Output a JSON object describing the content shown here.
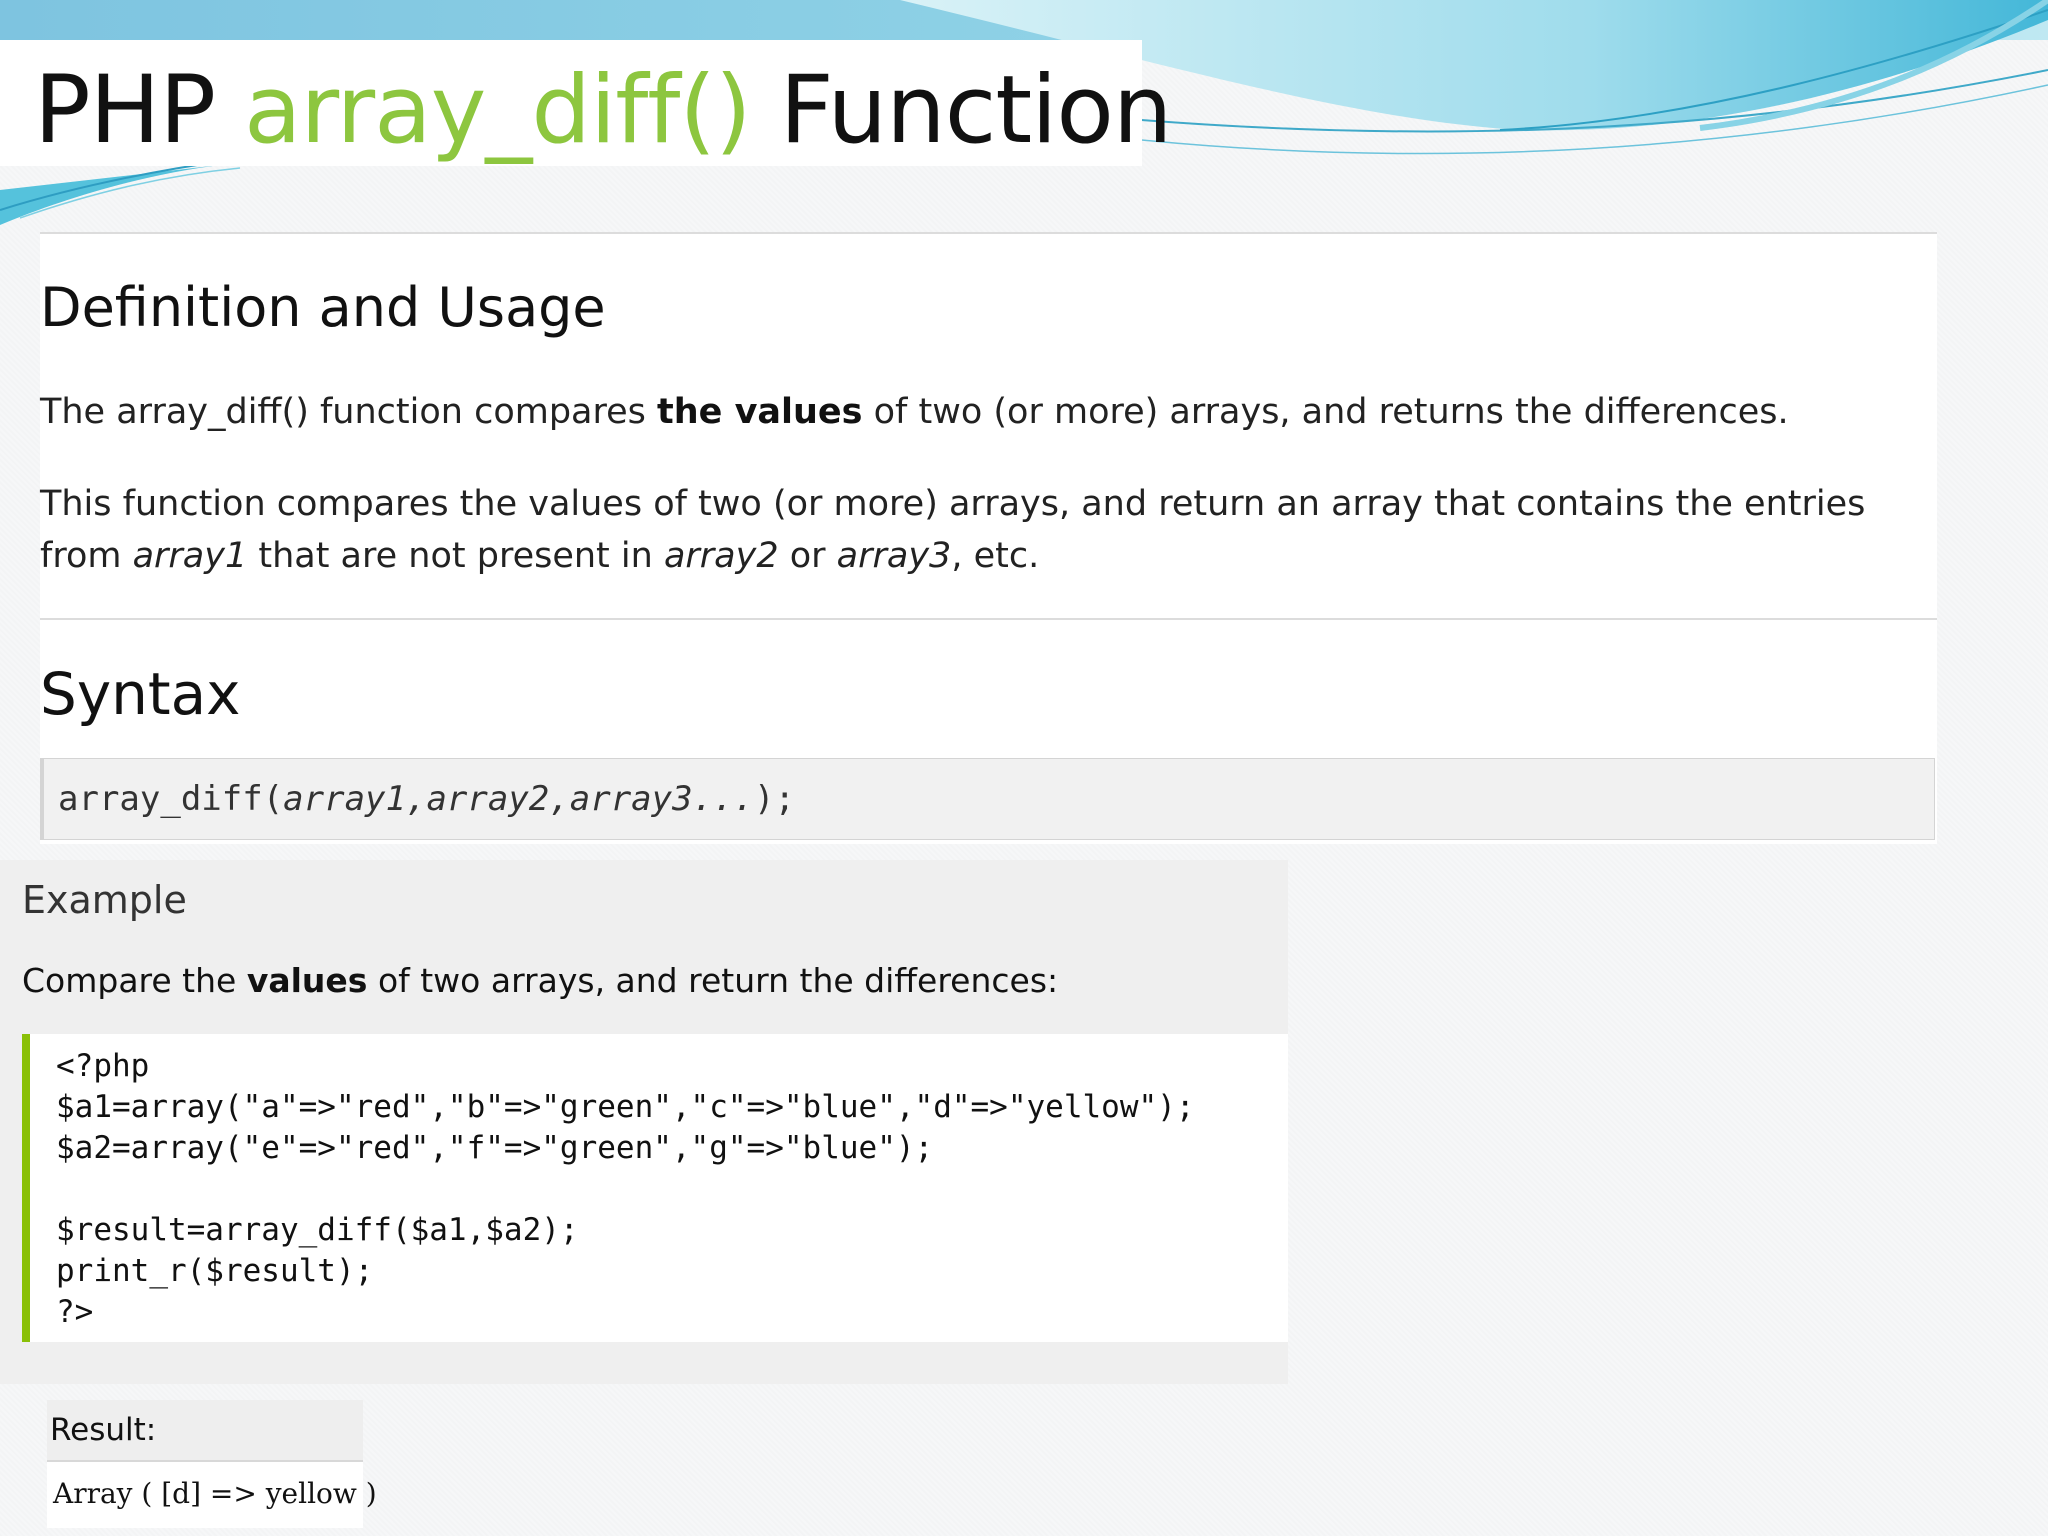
{
  "slide": {
    "title_prefix": "PHP ",
    "title_function": "array_diff()",
    "title_suffix": " Function"
  },
  "definition": {
    "heading": "Definition and Usage",
    "p1_before": "The array_diff() function compares ",
    "p1_bold": "the values",
    "p1_after": " of two (or more) arrays, and returns the differences.",
    "p2_start": "This function compares the values of two (or more) arrays, and return an array that contains the entries from ",
    "p2_em1": "array1",
    "p2_mid1": " that are not present in ",
    "p2_em2": "array2",
    "p2_mid2": " or ",
    "p2_em3": "array3",
    "p2_end": ", etc."
  },
  "syntax": {
    "heading": "Syntax",
    "code_fn": "array_diff(",
    "code_args": "array1,array2,array3...",
    "code_end": ");"
  },
  "example": {
    "heading": "Example",
    "desc_before": "Compare the ",
    "desc_bold": "values",
    "desc_after": " of two arrays, and return the differences:",
    "code_lines": [
      "<?php",
      "$a1=array(\"a\"=>\"red\",\"b\"=>\"green\",\"c\"=>\"blue\",\"d\"=>\"yellow\");",
      "$a2=array(\"e\"=>\"red\",\"f\"=>\"green\",\"g\"=>\"blue\");",
      "",
      "$result=array_diff($a1,$a2);",
      "print_r($result);",
      "?>"
    ]
  },
  "result": {
    "label": "Result:",
    "value": "Array ( [d] => yellow )"
  },
  "colors": {
    "function_green": "#8dc63f",
    "code_border_green": "#8ac007",
    "decor_blue": "#3fb7d6"
  }
}
